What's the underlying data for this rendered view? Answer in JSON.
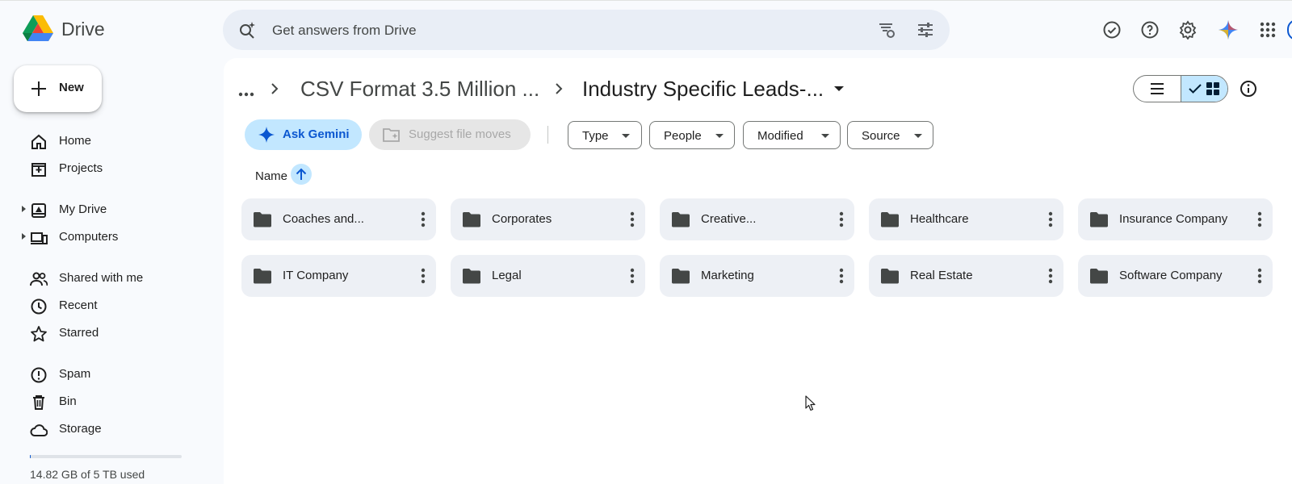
{
  "app": {
    "name": "Drive"
  },
  "search": {
    "placeholder": "Get answers from Drive"
  },
  "header_icons": [
    "tasks-check-icon",
    "help-icon",
    "settings-icon",
    "gemini-icon",
    "apps-grid-icon"
  ],
  "sidebar": {
    "new_label": "New",
    "items": [
      {
        "label": "Home",
        "icon": "home-icon"
      },
      {
        "label": "Projects",
        "icon": "projects-icon"
      },
      {
        "label": "My Drive",
        "icon": "my-drive-icon"
      },
      {
        "label": "Computers",
        "icon": "computers-icon"
      },
      {
        "label": "Shared with me",
        "icon": "shared-icon"
      },
      {
        "label": "Recent",
        "icon": "clock-icon"
      },
      {
        "label": "Starred",
        "icon": "star-icon"
      },
      {
        "label": "Spam",
        "icon": "spam-icon"
      },
      {
        "label": "Bin",
        "icon": "bin-icon"
      },
      {
        "label": "Storage",
        "icon": "cloud-icon"
      }
    ],
    "storage_text": "14.82 GB of 5 TB used",
    "storage_used_fraction": 0.003
  },
  "breadcrumb": {
    "parent": "CSV Format 3.5 Million ...",
    "current": "Industry Specific Leads-..."
  },
  "toolbar": {
    "ask_gemini": "Ask Gemini",
    "suggest_moves": "Suggest file moves",
    "filters": [
      "Type",
      "People",
      "Modified",
      "Source"
    ]
  },
  "list": {
    "sort_header": "Name",
    "folders": [
      "Coaches and...",
      "Corporates",
      "Creative...",
      "Healthcare",
      "Insurance Company",
      "IT Company",
      "Legal",
      "Marketing",
      "Real Estate",
      "Software Company"
    ]
  },
  "colors": {
    "background": "#f8fafd",
    "accent_blue": "#0b57d0",
    "selected_chip": "#c2e7ff",
    "folder_card": "#edf0f5"
  }
}
